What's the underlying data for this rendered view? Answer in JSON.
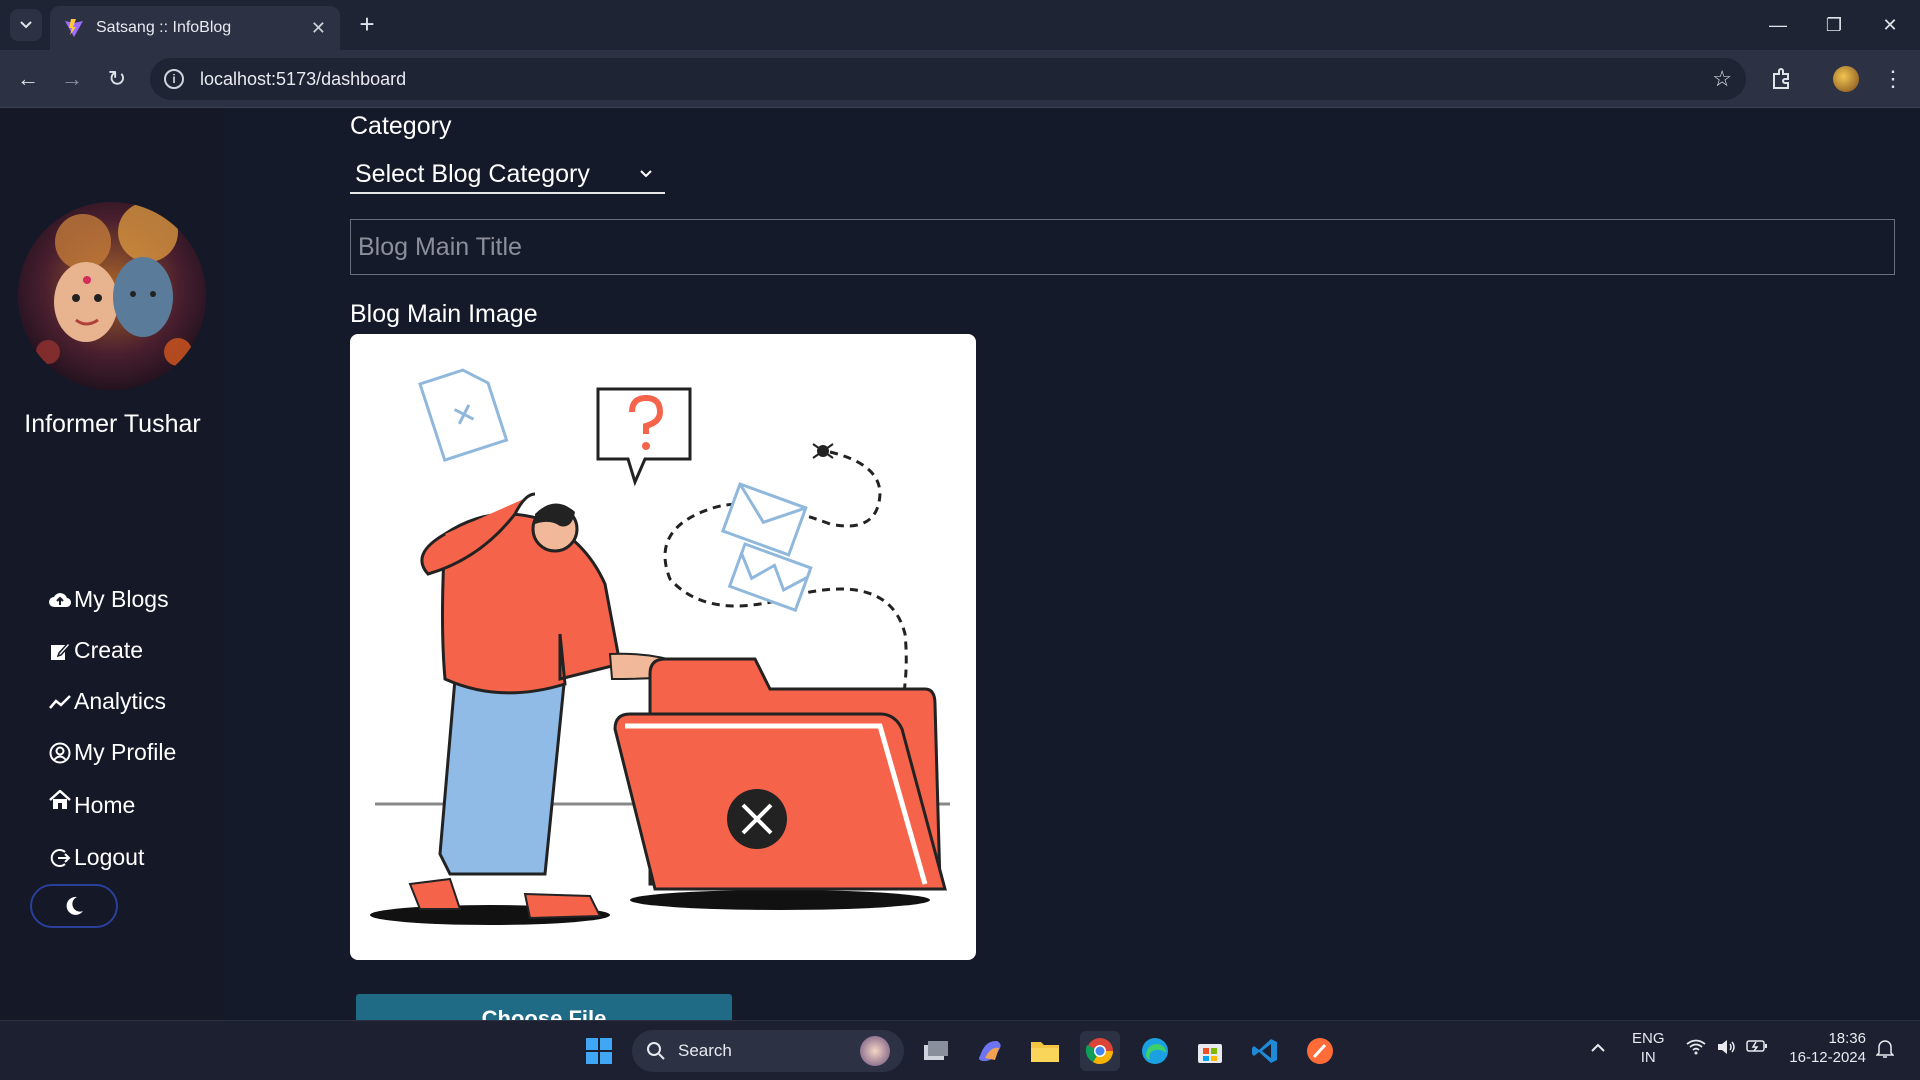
{
  "browser": {
    "tab_title": "Satsang :: InfoBlog",
    "url": "localhost:5173/dashboard"
  },
  "sidebar": {
    "user_name": "Informer Tushar",
    "items": [
      {
        "label": "My Blogs",
        "icon": "cloud-upload-icon"
      },
      {
        "label": "Create",
        "icon": "edit-icon"
      },
      {
        "label": "Analytics",
        "icon": "analytics-icon"
      },
      {
        "label": "My Profile",
        "icon": "user-circle-icon"
      },
      {
        "label": "Home",
        "icon": "home-icon"
      },
      {
        "label": "Logout",
        "icon": "logout-icon"
      }
    ],
    "theme_toggle_icon": "moon-icon"
  },
  "form": {
    "category_label": "Category",
    "category_selected": "Select Blog Category",
    "title_placeholder": "Blog Main Title",
    "image_label": "Blog Main Image",
    "choose_file_label": "Choose File"
  },
  "taskbar": {
    "search_label": "Search",
    "lang_top": "ENG",
    "lang_bottom": "IN",
    "time": "18:36",
    "date": "16-12-2024"
  },
  "colors": {
    "page_bg": "#151a2a",
    "sidebar_bg": "#141827",
    "button_bg": "#1f6b86",
    "accent_red": "#f4634a"
  }
}
